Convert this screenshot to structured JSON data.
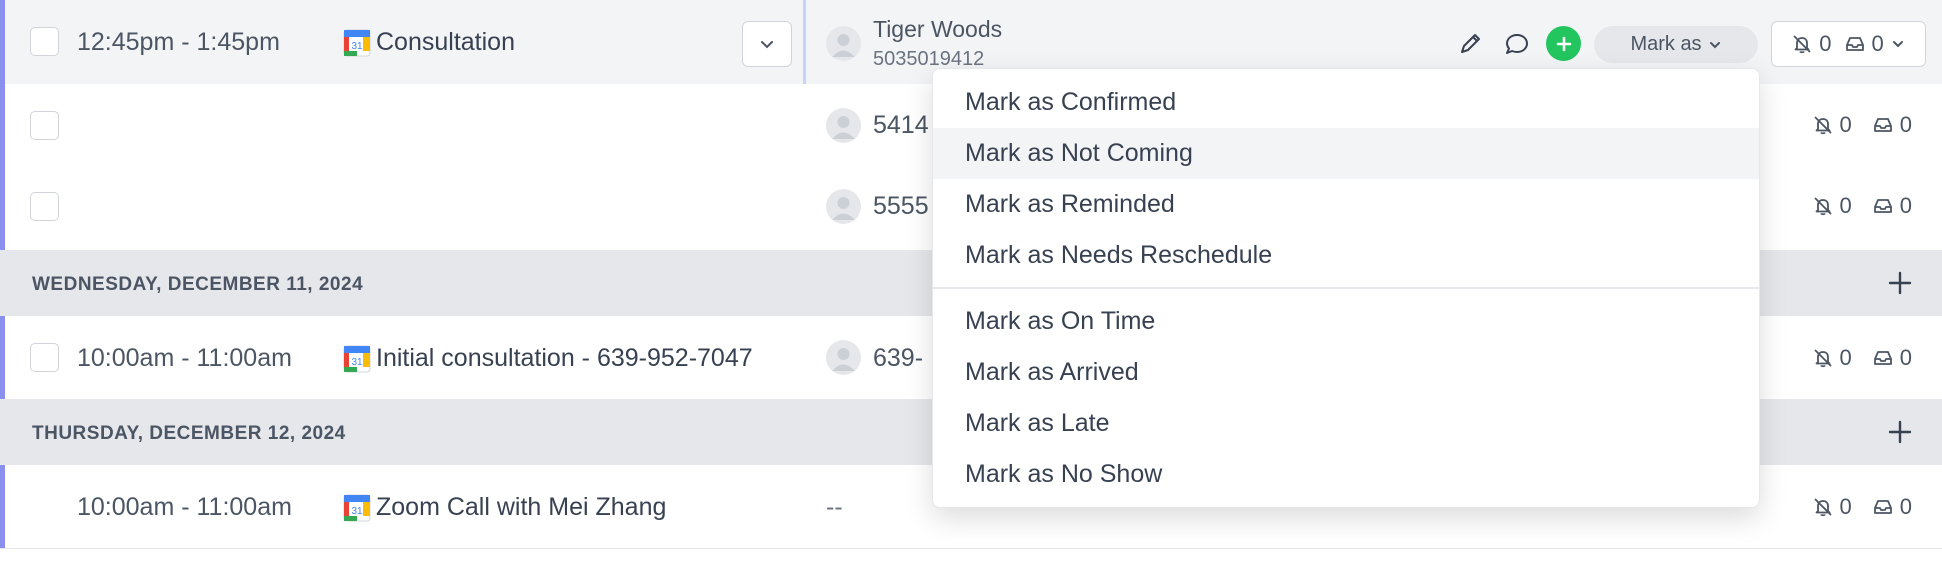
{
  "rows": [
    {
      "time": "12:45pm - 1:45pm",
      "title": "Consultation",
      "contact_name": "Tiger Woods",
      "contact_phone": "5035019412",
      "notif_count": "0",
      "inbox_count": "0"
    },
    {
      "contact_name": "5414",
      "notif_count": "0",
      "inbox_count": "0"
    },
    {
      "contact_name": "5555",
      "notif_count": "0",
      "inbox_count": "0"
    },
    {
      "time": "10:00am - 11:00am",
      "title": "Initial consultation - 639-952-7047",
      "contact_name": "639-",
      "notif_count": "0",
      "inbox_count": "0"
    },
    {
      "time": "10:00am - 11:00am",
      "title": "Zoom Call with Mei Zhang",
      "contact_name": "--",
      "notif_count": "0",
      "inbox_count": "0"
    }
  ],
  "sections": [
    {
      "label": "WEDNESDAY, DECEMBER 11, 2024"
    },
    {
      "label": "THURSDAY, DECEMBER 12, 2024"
    }
  ],
  "toolbar": {
    "mark_as_label": "Mark as"
  },
  "menu": {
    "groups": [
      [
        "Mark as Confirmed",
        "Mark as Not Coming",
        "Mark as Reminded",
        "Mark as Needs Reschedule"
      ],
      [
        "Mark as On Time",
        "Mark as Arrived",
        "Mark as Late",
        "Mark as No Show"
      ]
    ],
    "hovered_item": "Mark as Not Coming"
  },
  "colors": {
    "accent": "#8b8ff0",
    "green": "#22c55e",
    "section_bg": "#e5e7eb",
    "highlight_bg": "#f3f4f6"
  }
}
